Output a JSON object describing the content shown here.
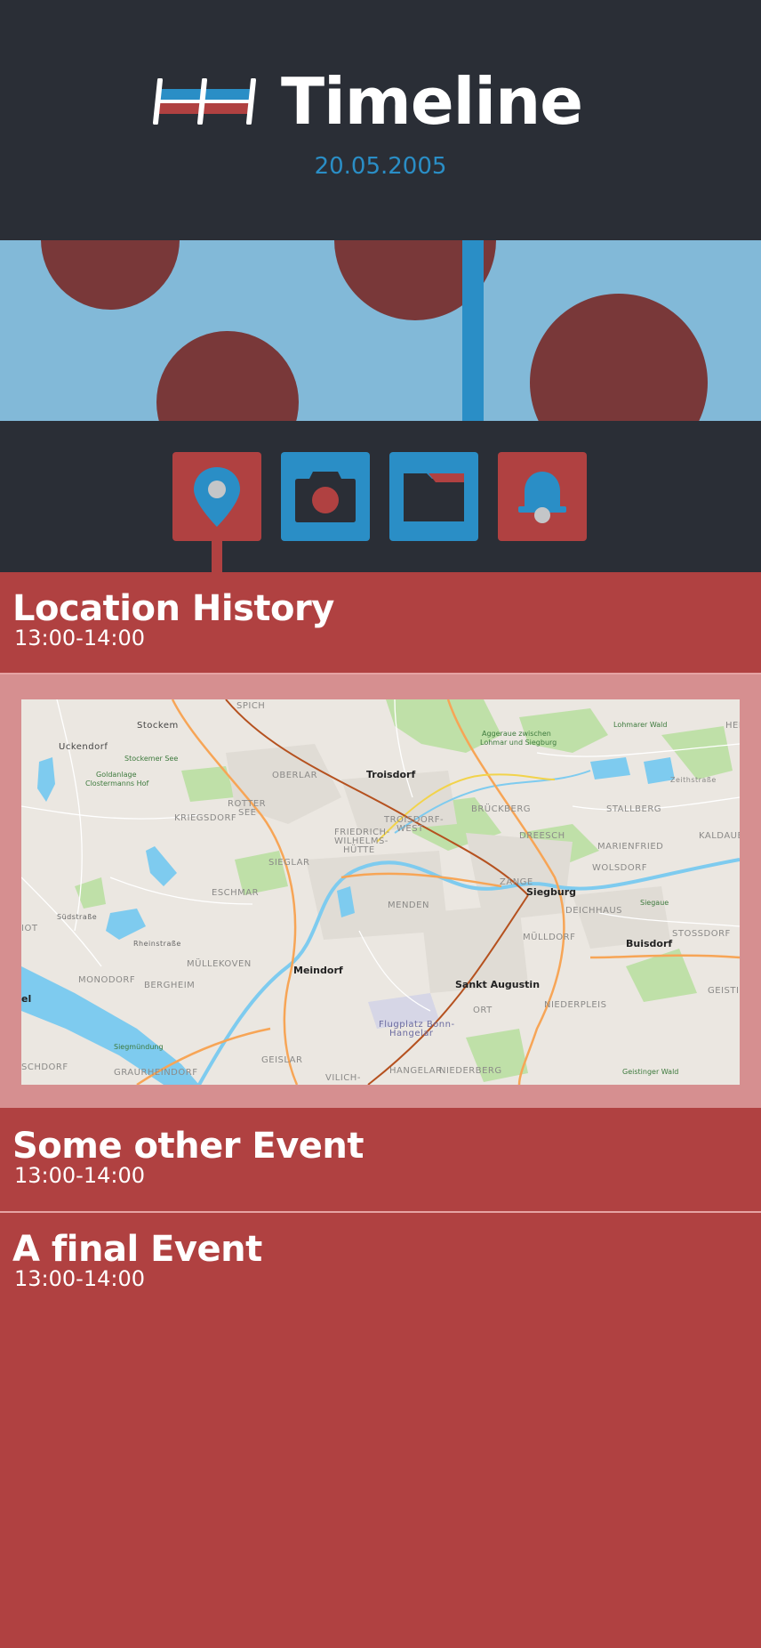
{
  "header": {
    "title": "Timeline",
    "date": "20.05.2005",
    "logo_icon": "timeline-logo-icon"
  },
  "colors": {
    "dark": "#2a2e36",
    "red": "#b04141",
    "blue": "#2a8ec6",
    "sky": "#82b9d8",
    "maroon": "#793839",
    "map_panel": "#d68f90"
  },
  "toolbar": {
    "items": [
      {
        "icon": "location-pin-icon",
        "active": true
      },
      {
        "icon": "camera-icon",
        "active": false
      },
      {
        "icon": "folder-icon",
        "active": false
      },
      {
        "icon": "bell-icon",
        "active": false
      }
    ]
  },
  "events": [
    {
      "title": "Location History",
      "time": "13:00-14:00"
    },
    {
      "title": "Some other Event",
      "time": "13:00-14:00"
    },
    {
      "title": "A final Event",
      "time": "13:00-14:00"
    }
  ],
  "map": {
    "labels": {
      "spich": "SPICH",
      "stockem": "Stockem",
      "uckendorf": "Uckendorf",
      "stockemer_see": "Stockemer See",
      "goldanlage": "Goldanlage",
      "clostermanns": "Clostermanns Hof",
      "oberlar": "OBERLAR",
      "troisdorf": "Troisdorf",
      "aggeraue": "Aggeraue zwischen",
      "lohmar": "Lohmar und Siegburg",
      "lohmarer_wald": "Lohmarer Wald",
      "kriegsdorf": "KRIEGSDORF",
      "rotter_see": "ROTTER",
      "see": "SEE",
      "troisdorf_west": "TROISDORF-",
      "west": "WEST",
      "friedrich": "FRIEDRICH-",
      "wilhelms": "WILHELMS-",
      "huette": "HÜTTE",
      "brueckberg": "BRÜCKBERG",
      "stallberg": "STALLBERG",
      "dreesch": "DREESCH",
      "marienfried": "MARIENFRIED",
      "kaldauen": "KALDAUEN",
      "sieglar": "SIEGLAR",
      "wolsdorf": "WOLSDORF",
      "eschmar": "ESCHMAR",
      "zange": "ZANGE",
      "siegburg": "Siegburg",
      "siegaue": "Siegaue",
      "menden": "MENDEN",
      "deichhaus": "DEICHHAUS",
      "buisdorf": "Buisdorf",
      "stossdorf": "STOSSDORF",
      "muellekoven": "MÜLLEKOVEN",
      "meindorf": "Meindorf",
      "muldorf": "MÜLLDORF",
      "monodorf": "MONODORF",
      "bergheim": "BERGHEIM",
      "sankt_augustin": "Sankt Augustin",
      "geistingen": "GEISTINGEN",
      "niederpleis": "NIEDERPLEIS",
      "ort": "ORT",
      "flugplatz": "Flugplatz Bonn-",
      "hangelar_fp": "Hangelar",
      "siegmuendung": "Siegmündung",
      "geislar": "GEISLAR",
      "schdorf": "SCHDORF",
      "graurheindorf": "GRAURHEINDORF",
      "hangelar": "HANGELAR",
      "niederberg": "NIEDERBERG",
      "vilich": "VILICH-",
      "geistinger_wald": "Geistinger Wald",
      "hei": "HEI",
      "iot": "IOT",
      "el": "el",
      "zeithstrasse": "Zeithstraße",
      "rheinstrasse": "Rheinstraße",
      "suedstrasse": "Südstraße"
    }
  }
}
